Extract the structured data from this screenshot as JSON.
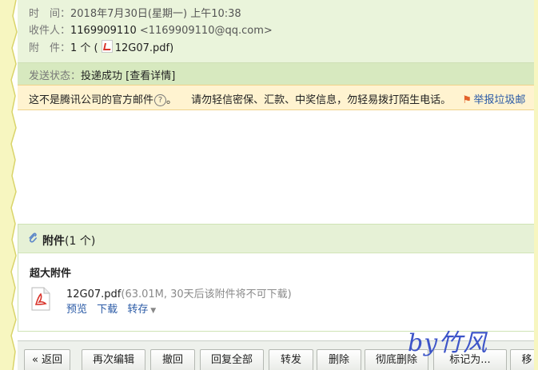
{
  "header": {
    "time_label": "时　间：",
    "time_value": "2018年7月30日(星期一) 上午10:38",
    "recipient_label": "收件人：",
    "recipient_name": "1169909110",
    "recipient_email": "<1169909110@qq.com>",
    "attachment_label": "附　件：",
    "attachment_count": "1 个 (",
    "attachment_file": "12G07.pdf",
    "attachment_close": ")"
  },
  "status": {
    "label": "发送状态：",
    "value": "投递成功",
    "detail_link": "[查看详情]"
  },
  "warning": {
    "notice": "这不是腾讯公司的官方邮件",
    "help_symbol": "?",
    "period": "。",
    "advice": "请勿轻信密保、汇款、中奖信息，勿轻易拨打陌生电话。",
    "report_link": "举报垃圾邮",
    "report_icon": "flag-icon"
  },
  "attachments": {
    "title": "附件",
    "count": "(1 个)",
    "section_title": "超大附件",
    "file_name": "12G07.pdf",
    "file_meta": "(63.01M, 30天后该附件将不可下载)",
    "actions": {
      "preview": "预览",
      "download": "下载",
      "save": "转存"
    }
  },
  "toolbar": {
    "back": "« 返回",
    "edit_again": "再次编辑",
    "recall": "撤回",
    "reply_all": "回复全部",
    "forward": "转发",
    "delete": "删除",
    "delete_forever": "彻底删除",
    "mark_as": "标记为...",
    "more": "移"
  },
  "watermark": "by竹风",
  "colors": {
    "header_bg": "#eaf4db",
    "status_bg": "#d7e9bf",
    "warning_bg": "#fff3d0",
    "link": "#2a5aa6",
    "frame_yellow": "#f4f088"
  }
}
